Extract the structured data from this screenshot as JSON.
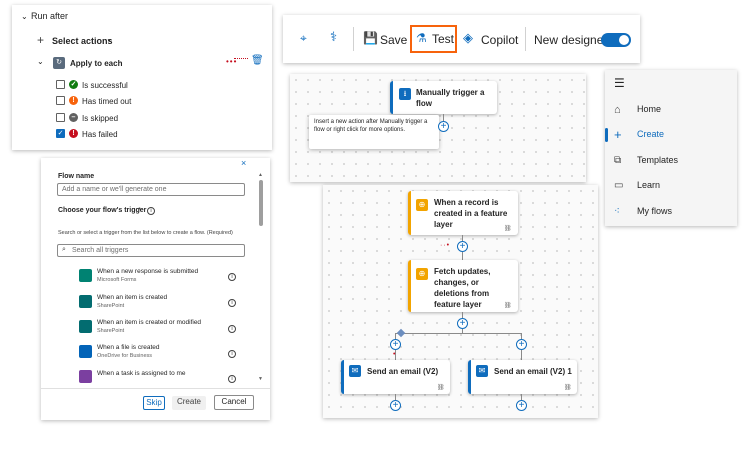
{
  "run_after": {
    "header": "Run after",
    "select_actions": "Select actions",
    "apply_to_each": "Apply to each",
    "options": [
      {
        "label": "Is successful",
        "checked": false,
        "color": "#107c10",
        "glyph": "✓"
      },
      {
        "label": "Has timed out",
        "checked": false,
        "color": "#f7630c",
        "glyph": "!"
      },
      {
        "label": "Is skipped",
        "checked": false,
        "color": "#616161",
        "glyph": "—"
      },
      {
        "label": "Has failed",
        "checked": true,
        "color": "#c50f1f",
        "glyph": "!"
      }
    ]
  },
  "flow_panel": {
    "flow_name_label": "Flow name",
    "flow_name_placeholder": "Add a name or we'll generate one",
    "trigger_label": "Choose your flow's trigger",
    "trigger_required": "*",
    "helper_text": "Search or select a trigger from the list below to create a flow. (Required)",
    "search_placeholder": "Search all triggers",
    "triggers": [
      {
        "title": "When a new response is submitted",
        "subtitle": "Microsoft Forms",
        "icon": "forms-icon",
        "color": "#008272"
      },
      {
        "title": "When an item is created",
        "subtitle": "SharePoint",
        "icon": "sharepoint-icon",
        "color": "#036c70"
      },
      {
        "title": "When an item is created or modified",
        "subtitle": "SharePoint",
        "icon": "sharepoint-icon",
        "color": "#036c70"
      },
      {
        "title": "When a file is created",
        "subtitle": "OneDrive for Business",
        "icon": "onedrive-icon",
        "color": "#0364b8"
      },
      {
        "title": "When a task is assigned to me",
        "subtitle": "",
        "icon": "planner-icon",
        "color": "#7b3fa0"
      }
    ],
    "skip": "Skip",
    "create": "Create",
    "cancel": "Cancel"
  },
  "toolbar": {
    "save": "Save",
    "test": "Test",
    "copilot": "Copilot",
    "new_designer": "New designer",
    "new_designer_on": true,
    "highlight_color": "#f7630c",
    "accent": "#0f6cbd"
  },
  "canvas_top": {
    "trigger_node": "Manually trigger a flow",
    "tooltip": "Insert a new action after Manually trigger a flow or right click for more options."
  },
  "canvas_main": {
    "node1": "When a record is created in a feature layer",
    "node2": "Fetch updates, changes, or deletions from feature layer",
    "email1": "Send an email (V2)",
    "email2": "Send an email (V2) 1",
    "esri_color": "#f2a400",
    "outlook_color": "#0f6cbd"
  },
  "nav": {
    "items": [
      {
        "label": "Home",
        "icon": "home-icon"
      },
      {
        "label": "Create",
        "icon": "plus-icon",
        "active": true
      },
      {
        "label": "Templates",
        "icon": "templates-icon"
      },
      {
        "label": "Learn",
        "icon": "book-icon"
      },
      {
        "label": "My flows",
        "icon": "flows-icon"
      }
    ]
  }
}
